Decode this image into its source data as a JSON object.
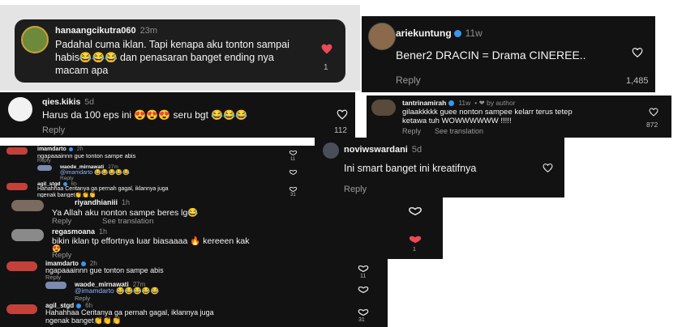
{
  "c1": {
    "user": "hanaangcikutra060",
    "time": "23m",
    "line1": "Padahal cuma iklan. Tapi kenapa aku tonton sampai",
    "line2": "habis😂😂😂 dan penasaran banget ending nya",
    "line3": "macam apa",
    "likes": "1"
  },
  "c2": {
    "user": "ariekuntung",
    "time": "11w",
    "text": "Bener2 DRACIN = Drama CINEREE..",
    "reply": "Reply",
    "likes": "1,485"
  },
  "c3": {
    "user": "qies.kikis",
    "time": "5d",
    "text": "Harus da 100 eps ini 😍😍😍 seru bgt 😂😂😂",
    "reply": "Reply",
    "likes": "112"
  },
  "c4": {
    "user": "tantrinamirah",
    "time": "11w",
    "by": "• ❤ by author",
    "line1": "gilaakkkkk guee nonton sampee kelarr terus tetep",
    "line2": "ketawa tuh WOWWWWWW !!!!!",
    "reply": "Reply",
    "see": "See translation",
    "likes": "872"
  },
  "c5": {
    "user": "noviwswardani",
    "time": "5d",
    "text": "Ini smart banget ini kreatifnya",
    "reply": "Reply"
  },
  "thread1": {
    "a": {
      "user": "imamdarto",
      "time": "2h",
      "text": "ngapaaainnn gue tonton sampe abis",
      "reply": "Reply",
      "likes": "11"
    },
    "b": {
      "user": "waode_mirnawati",
      "time": "27m",
      "text": "@imamdarto 😂😂😂😂😂",
      "reply": "Reply"
    },
    "c": {
      "user": "agil_stgd",
      "time": "6h",
      "line1": "Hahahhaa Ceritanya ga pernah gagal, iklannya juga",
      "line2": "ngenak banget👏👏👏",
      "likes": "31"
    }
  },
  "c6": {
    "user": "riyandhianiii",
    "time": "1h",
    "text": "Ya Allah aku nonton sampe beres lg😂",
    "reply": "Reply",
    "see": "See translation"
  },
  "c7": {
    "user": "regasmoana",
    "time": "1h",
    "line1": "bikin iklan tp effortnya luar biasaaaa 🔥 kereeen kak",
    "line2": "😍",
    "reply": "Reply",
    "likes": "1"
  },
  "thread2": {
    "a": {
      "user": "imamdarto",
      "time": "2h",
      "text": "ngapaaainnn gue tonton sampe abis",
      "reply": "Reply",
      "likes": "11"
    },
    "b": {
      "user": "waode_mirnawati",
      "time": "27m",
      "text": "@imamdarto 😂😂😂😂😂",
      "reply": "Reply"
    },
    "c": {
      "user": "agil_stgd",
      "time": "6h",
      "line1": "Hahahhaa Ceritanya ga pernah gagal, iklannya juga",
      "line2": "ngenak banget👏👏👏",
      "likes": "31"
    }
  },
  "colors": {
    "bg": "#121212",
    "like_red": "#ed4956",
    "verified": "#3897f0"
  },
  "icons": [
    "heart-outline-icon",
    "heart-filled-icon",
    "verified-badge-icon",
    "avatar"
  ]
}
